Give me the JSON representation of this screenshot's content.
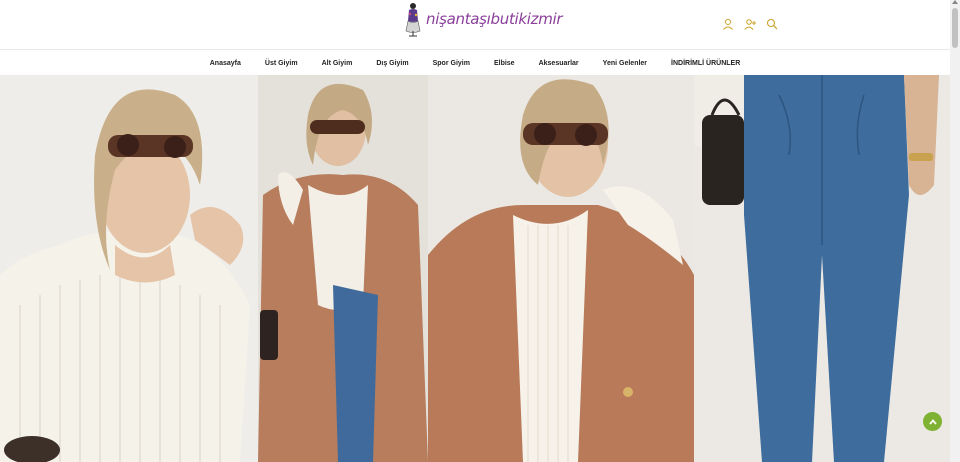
{
  "header": {
    "logo_text": "nişantaşıbutikizmir",
    "icons": [
      "user-icon",
      "add-user-icon",
      "search-icon"
    ]
  },
  "nav": {
    "items": [
      {
        "label": "Anasayfa"
      },
      {
        "label": "Üst Giyim"
      },
      {
        "label": "Alt Giyim"
      },
      {
        "label": "Dış Giyim"
      },
      {
        "label": "Spor Giyim"
      },
      {
        "label": "Elbise"
      },
      {
        "label": "Aksesuarlar"
      },
      {
        "label": "Yeni Gelenler"
      },
      {
        "label": "İNDİRİMLİ ÜRÜNLER"
      }
    ]
  },
  "colors": {
    "brand": "#8a3f9a",
    "accent_icon": "#c9a227",
    "to_top_button": "#7fb132"
  }
}
